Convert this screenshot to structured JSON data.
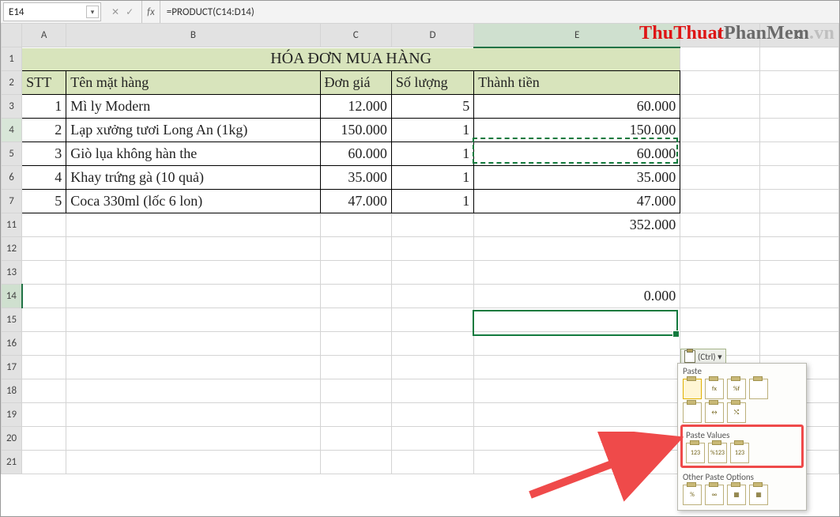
{
  "formula_bar": {
    "namebox": "E14",
    "fx_label": "fx",
    "formula": "=PRODUCT(C14:D14)"
  },
  "columns": [
    "A",
    "B",
    "C",
    "D",
    "E",
    "F",
    "G"
  ],
  "rows_visible": [
    "1",
    "2",
    "3",
    "4",
    "5",
    "6",
    "7",
    "11",
    "12",
    "13",
    "14",
    "15",
    "16",
    "17",
    "18",
    "19",
    "20",
    "21"
  ],
  "title": "HÓA ĐƠN MUA HÀNG",
  "headers": {
    "stt": "STT",
    "ten": "Tên mặt hàng",
    "dongia": "Đơn giá",
    "soluong": "Số lượng",
    "thanhtien": "Thành tiền"
  },
  "rows_data": [
    {
      "stt": "1",
      "ten": "Mì ly Modern",
      "dongia": "12.000",
      "sl": "5",
      "tt": "60.000"
    },
    {
      "stt": "2",
      "ten": "Lạp xưởng tươi Long An (1kg)",
      "dongia": "150.000",
      "sl": "1",
      "tt": "150.000"
    },
    {
      "stt": "3",
      "ten": "Giò lụa không hàn the",
      "dongia": "60.000",
      "sl": "1",
      "tt": "60.000"
    },
    {
      "stt": "4",
      "ten": "Khay trứng gà (10 quả)",
      "dongia": "35.000",
      "sl": "1",
      "tt": "35.000"
    },
    {
      "stt": "5",
      "ten": "Coca 330ml (lốc 6 lon)",
      "dongia": "47.000",
      "sl": "1",
      "tt": "47.000"
    }
  ],
  "total_e11": "352.000",
  "e14": "0.000",
  "paste": {
    "chip": "(Ctrl) ▾",
    "section_paste": "Paste",
    "section_values": "Paste Values",
    "section_other": "Other Paste Options",
    "i_fx": "fx",
    "i_pcf": "%f",
    "i_pct": "%",
    "i_123": "123",
    "i_link": "∞"
  },
  "watermark": {
    "p1": "ThuThuat",
    "p2": "PhanMem",
    "p3": ".vn"
  },
  "chart_data": {
    "type": "table",
    "title": "HÓA ĐƠN MUA HÀNG",
    "columns": [
      "STT",
      "Tên mặt hàng",
      "Đơn giá",
      "Số lượng",
      "Thành tiền"
    ],
    "rows": [
      [
        1,
        "Mì ly Modern",
        12000,
        5,
        60000
      ],
      [
        2,
        "Lạp xưởng tươi Long An (1kg)",
        150000,
        1,
        150000
      ],
      [
        3,
        "Giò lụa không hàn the",
        60000,
        1,
        60000
      ],
      [
        4,
        "Khay trứng gà (10 quả)",
        35000,
        1,
        35000
      ],
      [
        5,
        "Coca 330ml (lốc 6 lon)",
        47000,
        1,
        47000
      ]
    ],
    "total_thanh_tien": 352000,
    "active_cell": {
      "ref": "E14",
      "formula": "=PRODUCT(C14:D14)",
      "value": 0
    },
    "copied_cell": "E4"
  }
}
